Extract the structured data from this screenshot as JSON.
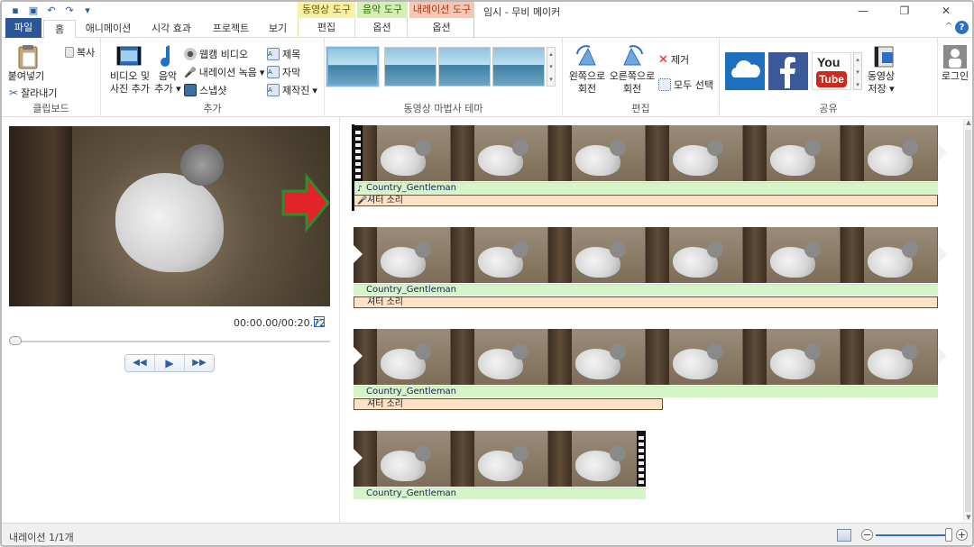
{
  "window": {
    "title": "임시 - 무비 메이커",
    "ctx_groups": [
      "동영상 도구",
      "음악 도구",
      "내레이션 도구"
    ],
    "controls": [
      "—",
      "❐",
      "✕"
    ]
  },
  "tabs": {
    "file": "파일",
    "home": "홈",
    "animation": "애니메이션",
    "visual": "시각 효과",
    "project": "프로젝트",
    "view": "보기",
    "edit": "편집",
    "music_option": "옵션",
    "narr_option": "옵션"
  },
  "ribbon": {
    "clipboard": {
      "paste": "붙여넣기",
      "copy": "복사",
      "cut": "잘라내기",
      "label": "클립보드"
    },
    "add": {
      "add_video_line1": "비디오 및",
      "add_video_line2": "사진 추가",
      "music_line1": "음악",
      "music_line2": "추가",
      "webcam": "웹캠 비디오",
      "narration": "내레이션 녹음",
      "snapshot": "스냅샷",
      "title": "제목",
      "caption": "자막",
      "credits": "제작진",
      "label": "추가"
    },
    "themes": {
      "label": "동영상 마법사 테마"
    },
    "editing": {
      "rotate_left_1": "왼쪽으로",
      "rotate_left_2": "회전",
      "rotate_right_1": "오른쪽으로",
      "rotate_right_2": "회전",
      "remove": "제거",
      "select_all": "모두 선택",
      "label": "편집"
    },
    "share": {
      "youtube_text": "You",
      "youtube_text2": "Tube",
      "save_movie_1": "동영상",
      "save_movie_2": "저장",
      "signin": "로그인",
      "label": "공유"
    }
  },
  "preview": {
    "timecode": "00:00.00/00:20.72",
    "playback_progress": 0
  },
  "storyboard": {
    "music_label": "Country_Gentleman",
    "narration_label": "셔터 소리",
    "rows": [
      {
        "music": "Country_Gentleman",
        "narration": "셔터 소리"
      },
      {
        "music": "Country_Gentleman",
        "narration": "셔터 소리"
      },
      {
        "music": "Country_Gentleman",
        "narration": "셔터 소리"
      },
      {
        "music": "Country_Gentleman"
      }
    ]
  },
  "status": {
    "text": "내레이션 1/1개"
  },
  "colors": {
    "accent": "#2b579a",
    "music_bar": "#d5f5c9",
    "narration_bar": "#fde2c7",
    "youtube_red": "#cc2a1f",
    "facebook_blue": "#3b5998",
    "onedrive_blue": "#1f6fbf"
  }
}
